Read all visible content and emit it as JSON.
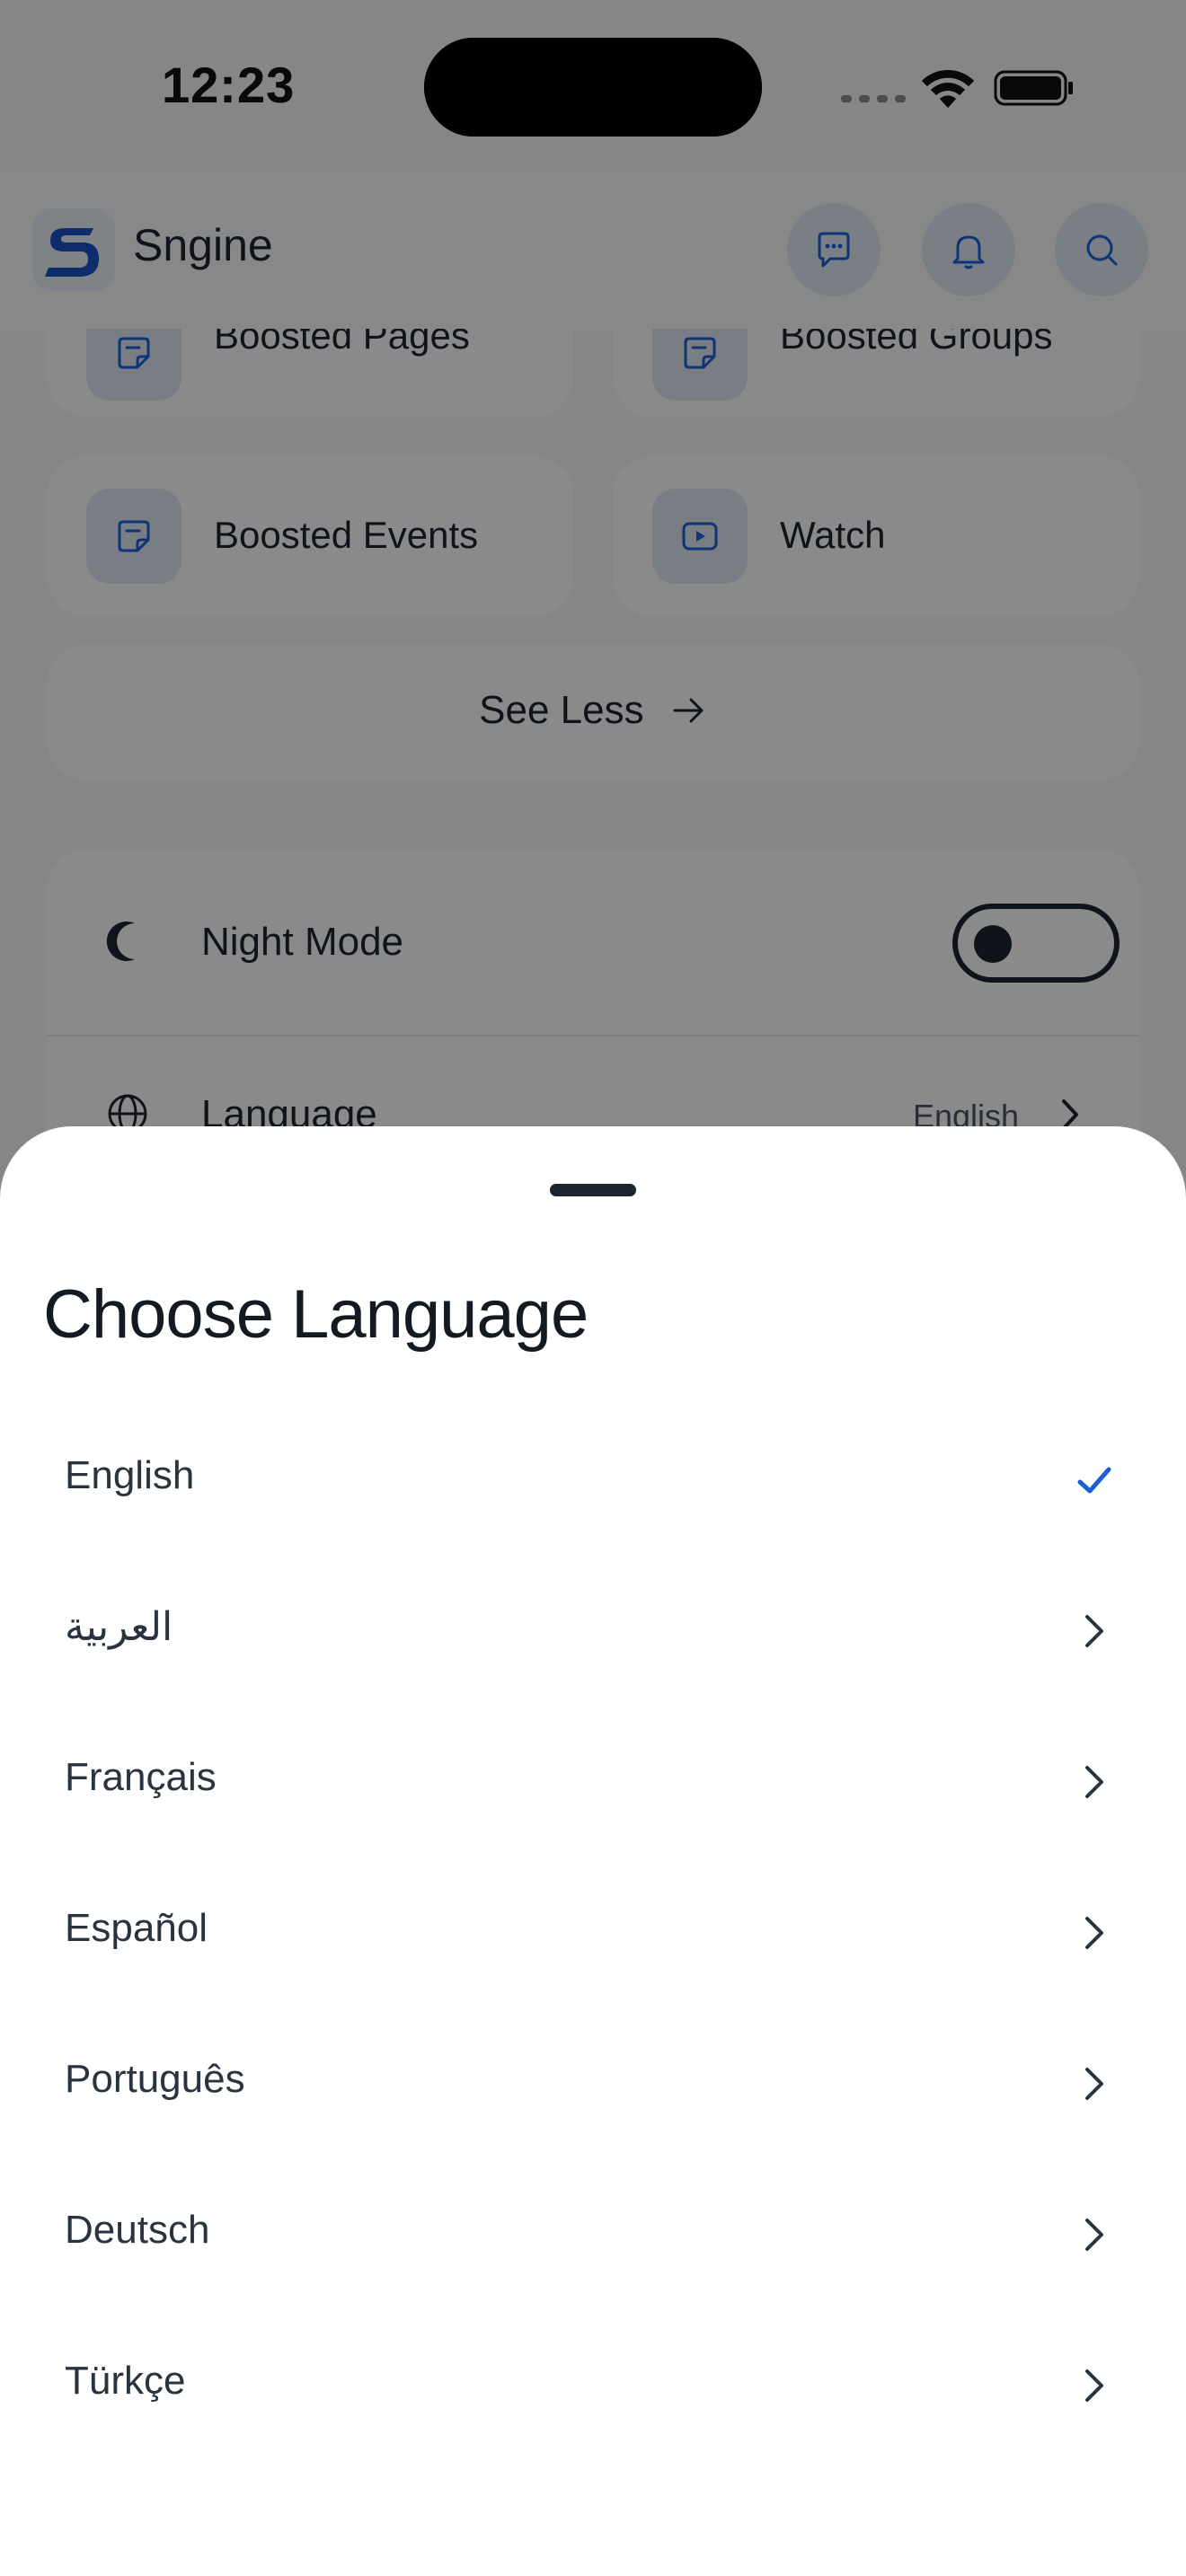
{
  "status_bar": {
    "time": "12:23"
  },
  "header": {
    "brand": "Sngine",
    "logo_letter": "S",
    "icons": [
      "chat-icon",
      "bell-icon",
      "search-icon"
    ]
  },
  "menu_tiles": [
    {
      "label": "Boosted Pages",
      "icon": "sticker-icon"
    },
    {
      "label": "Boosted Groups",
      "icon": "sticker-icon"
    },
    {
      "label": "Boosted Events",
      "icon": "sticker-icon"
    },
    {
      "label": "Watch",
      "icon": "play-icon"
    }
  ],
  "see_less": {
    "label": "See Less"
  },
  "settings": {
    "night_mode": {
      "label": "Night Mode",
      "enabled": false
    },
    "language": {
      "label": "Language",
      "value": "English"
    }
  },
  "sheet": {
    "title": "Choose Language",
    "languages": [
      {
        "label": "English",
        "selected": true
      },
      {
        "label": "العربية",
        "selected": false
      },
      {
        "label": "Français",
        "selected": false
      },
      {
        "label": "Español",
        "selected": false
      },
      {
        "label": "Português",
        "selected": false
      },
      {
        "label": "Deutsch",
        "selected": false
      },
      {
        "label": "Türkçe",
        "selected": false
      }
    ]
  },
  "colors": {
    "accent": "#1a5fd6",
    "text": "#1c2430",
    "overlay": "rgba(0,0,0,0.45)"
  }
}
